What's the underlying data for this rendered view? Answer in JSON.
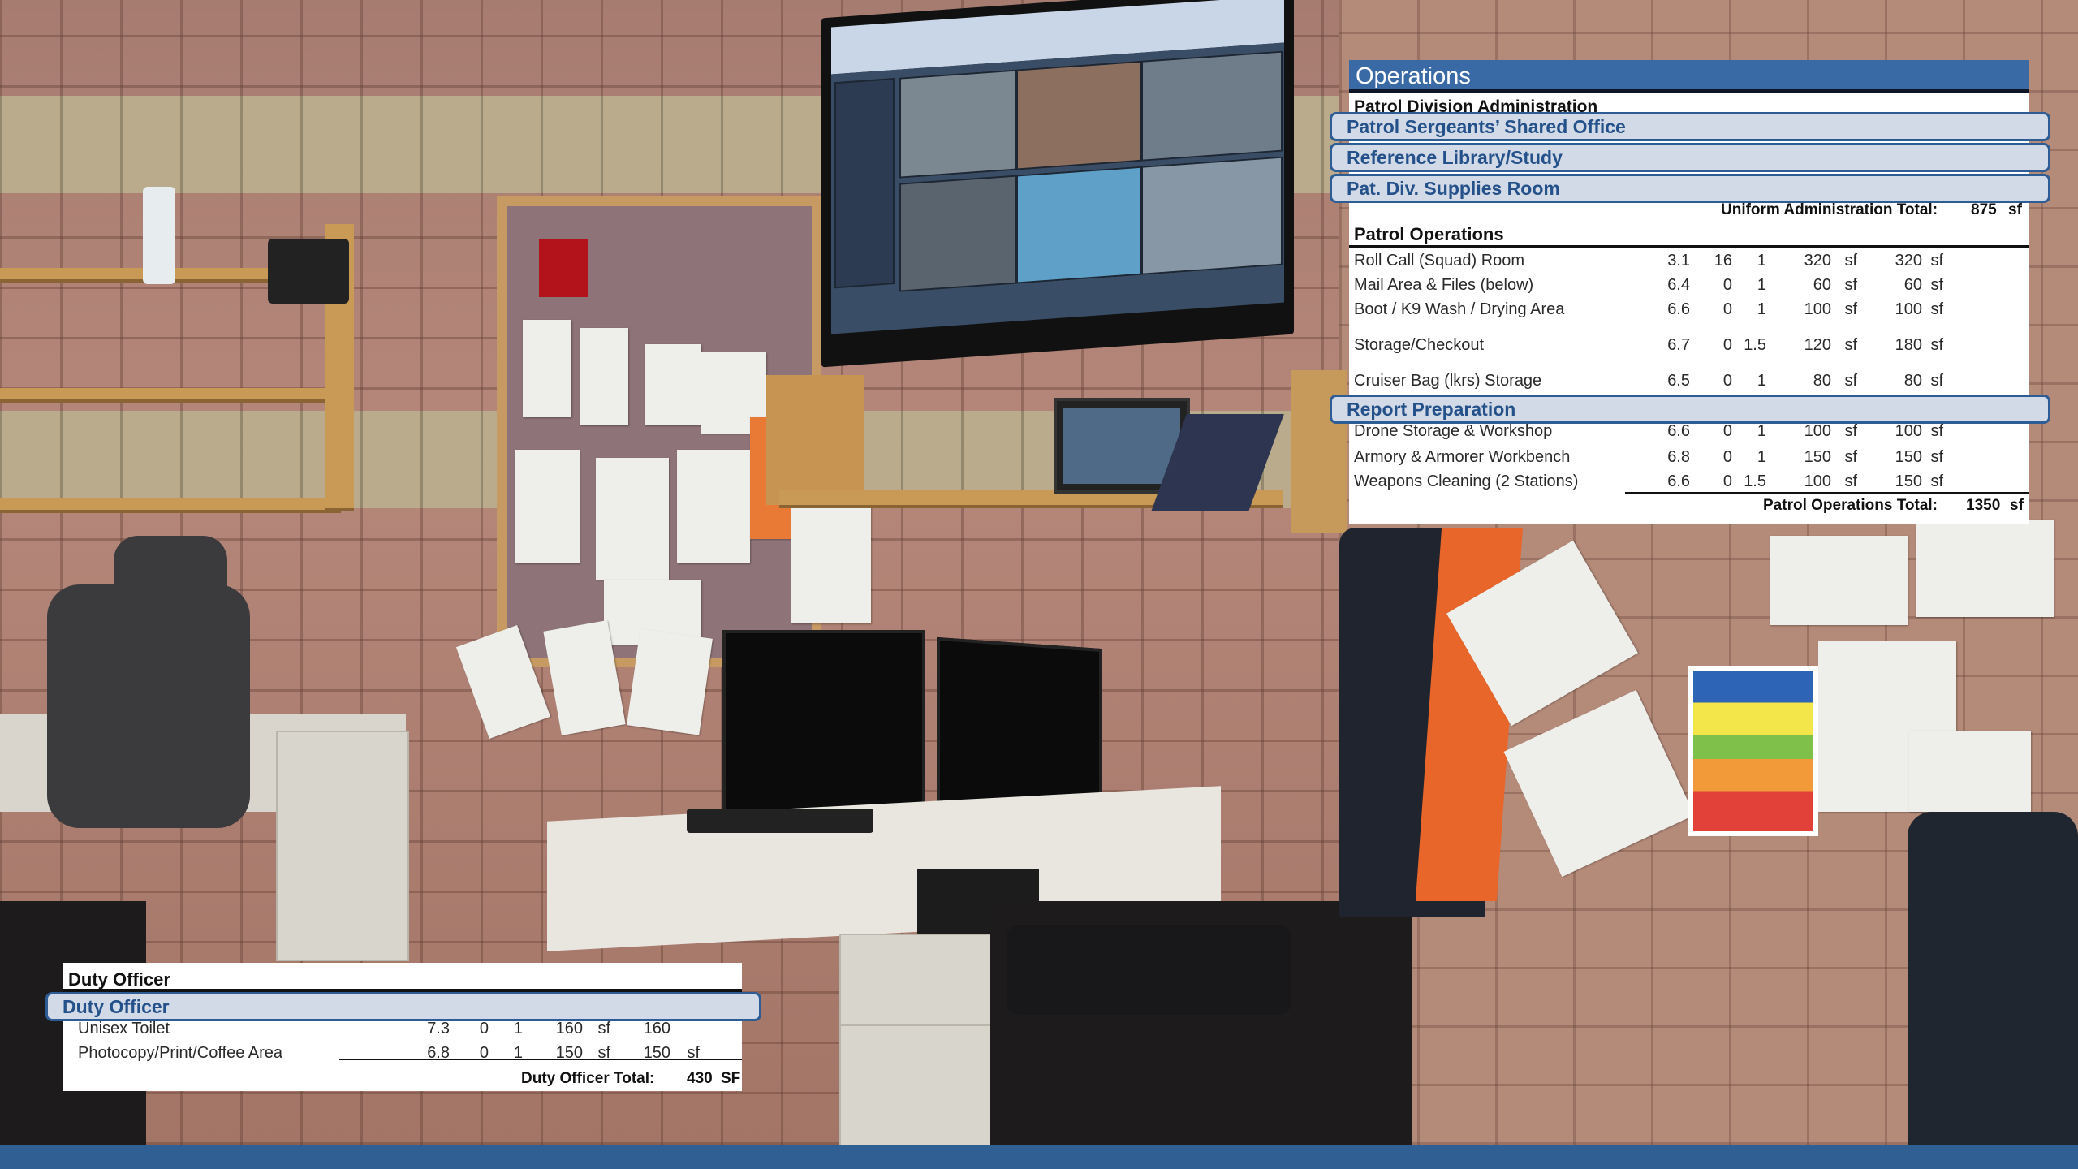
{
  "operations": {
    "title": "Operations",
    "subheading": "Patrol Division Administration",
    "admin_items": [
      "Patrol Sergeants’ Shared Office",
      "Reference Library/Study",
      "Pat. Div. Supplies Room"
    ],
    "admin_total_label": "Uniform Administration Total:",
    "admin_total_value": "875",
    "admin_total_unit": "sf",
    "patrol_header": "Patrol Operations",
    "patrol_rows": [
      {
        "name": "Roll Call (Squad) Room",
        "c1": "3.1",
        "c2": "16",
        "c3": "1",
        "area": "320",
        "u1": "sf",
        "total": "320",
        "u2": "sf"
      },
      {
        "name": "Mail Area & Files (below)",
        "c1": "6.4",
        "c2": "0",
        "c3": "1",
        "area": "60",
        "u1": "sf",
        "total": "60",
        "u2": "sf"
      },
      {
        "name": "Boot / K9 Wash / Drying Area",
        "c1": "6.6",
        "c2": "0",
        "c3": "1",
        "area": "100",
        "u1": "sf",
        "total": "100",
        "u2": "sf"
      },
      {
        "name": "Storage/Checkout",
        "c1": "6.7",
        "c2": "0",
        "c3": "1.5",
        "area": "120",
        "u1": "sf",
        "total": "180",
        "u2": "sf"
      },
      {
        "name": "Cruiser Bag (lkrs) Storage",
        "c1": "6.5",
        "c2": "0",
        "c3": "1",
        "area": "80",
        "u1": "sf",
        "total": "80",
        "u2": "sf"
      }
    ],
    "report_prep": "Report Preparation",
    "patrol_rows_2": [
      {
        "name": "Drone Storage & Workshop",
        "c1": "6.6",
        "c2": "0",
        "c3": "1",
        "area": "100",
        "u1": "sf",
        "total": "100",
        "u2": "sf"
      },
      {
        "name": "Armory & Armorer Workbench",
        "c1": "6.8",
        "c2": "0",
        "c3": "1",
        "area": "150",
        "u1": "sf",
        "total": "150",
        "u2": "sf"
      },
      {
        "name": "Weapons Cleaning (2 Stations)",
        "c1": "6.6",
        "c2": "0",
        "c3": "1.5",
        "area": "100",
        "u1": "sf",
        "total": "150",
        "u2": "sf"
      }
    ],
    "patrol_total_label": "Patrol Operations Total:",
    "patrol_total_value": "1350",
    "patrol_total_unit": "sf"
  },
  "duty": {
    "header": "Duty Officer",
    "pill": "Duty Officer",
    "rows": [
      {
        "name": "Unisex Toilet",
        "c1": "7.3",
        "c2": "0",
        "c3": "1",
        "area": "160",
        "u1": "sf",
        "total": "160",
        "u2": ""
      },
      {
        "name": "Photocopy/Print/Coffee Area",
        "c1": "6.8",
        "c2": "0",
        "c3": "1",
        "area": "150",
        "u1": "sf",
        "total": "150",
        "u2": "sf"
      }
    ],
    "total_label": "Duty Officer Total:",
    "total_value": "430",
    "total_unit": "SF"
  },
  "colors": {
    "header_blue": "#3a6aa6",
    "pill_fill": "#d2dae7",
    "pill_text": "#24518a",
    "bottom_bar": "#2f5f93"
  }
}
